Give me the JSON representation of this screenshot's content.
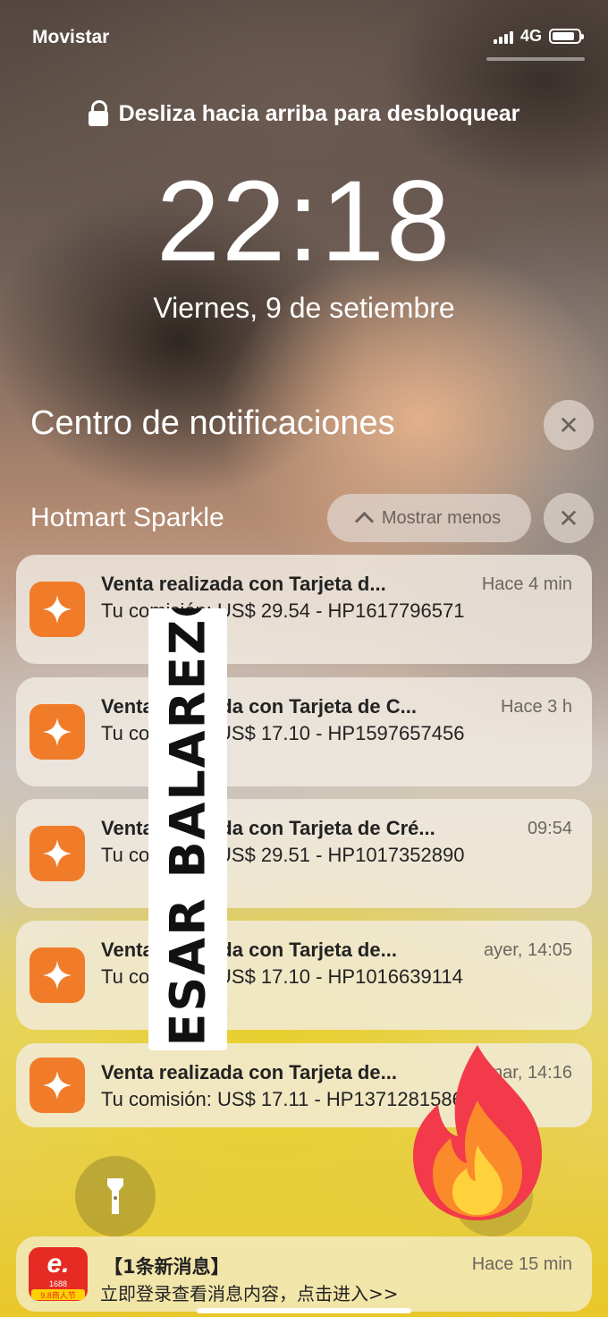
{
  "status_bar": {
    "carrier": "Movistar",
    "network": "4G",
    "battery_level": 0.85
  },
  "lock_screen": {
    "unlock_hint": "Desliza hacia arriba para desbloquear",
    "time": "22:18",
    "date": "Viernes, 9 de setiembre"
  },
  "notification_center": {
    "title": "Centro de notificaciones",
    "group": {
      "app_name": "Hotmart Sparkle",
      "show_less_label": "Mostrar menos",
      "notifications": [
        {
          "title": "Venta realizada con Tarjeta d...",
          "time": "Hace 4 min",
          "body": "Tu comisión: US$ 29.54 - HP1617796571"
        },
        {
          "title": "Venta realizada con Tarjeta de C...",
          "time": "Hace 3 h",
          "body": "Tu comisión: US$ 17.10 - HP1597657456"
        },
        {
          "title": "Venta realizada con Tarjeta de Cré...",
          "time": "09:54",
          "body": "Tu comisión: US$ 29.51 - HP1017352890"
        },
        {
          "title": "Venta realizada con Tarjeta de...",
          "time": "ayer, 14:05",
          "body": "Tu comisión: US$ 17.10 - HP1016639114"
        },
        {
          "title": "Venta realizada con Tarjeta de...",
          "time": "mar, 14:16",
          "body": "Tu comisión: US$ 17.11 - HP1371281586"
        }
      ]
    },
    "other": {
      "title": "【1条新消息】",
      "time": "Hace 15 min",
      "body": "立即登录查看消息内容，点击进入>>",
      "app_icon_text": "1688",
      "app_icon_badge": "9.8商人节"
    }
  },
  "watermark": {
    "text": "CESAR BALAREZO"
  },
  "colors": {
    "hotmart_orange": "#f07c2a",
    "alibaba_red": "#e62b24"
  },
  "icons": [
    "lock-icon",
    "close-icon",
    "chevron-up-icon",
    "sparkle-icon",
    "flashlight-icon",
    "fire-emoji"
  ]
}
